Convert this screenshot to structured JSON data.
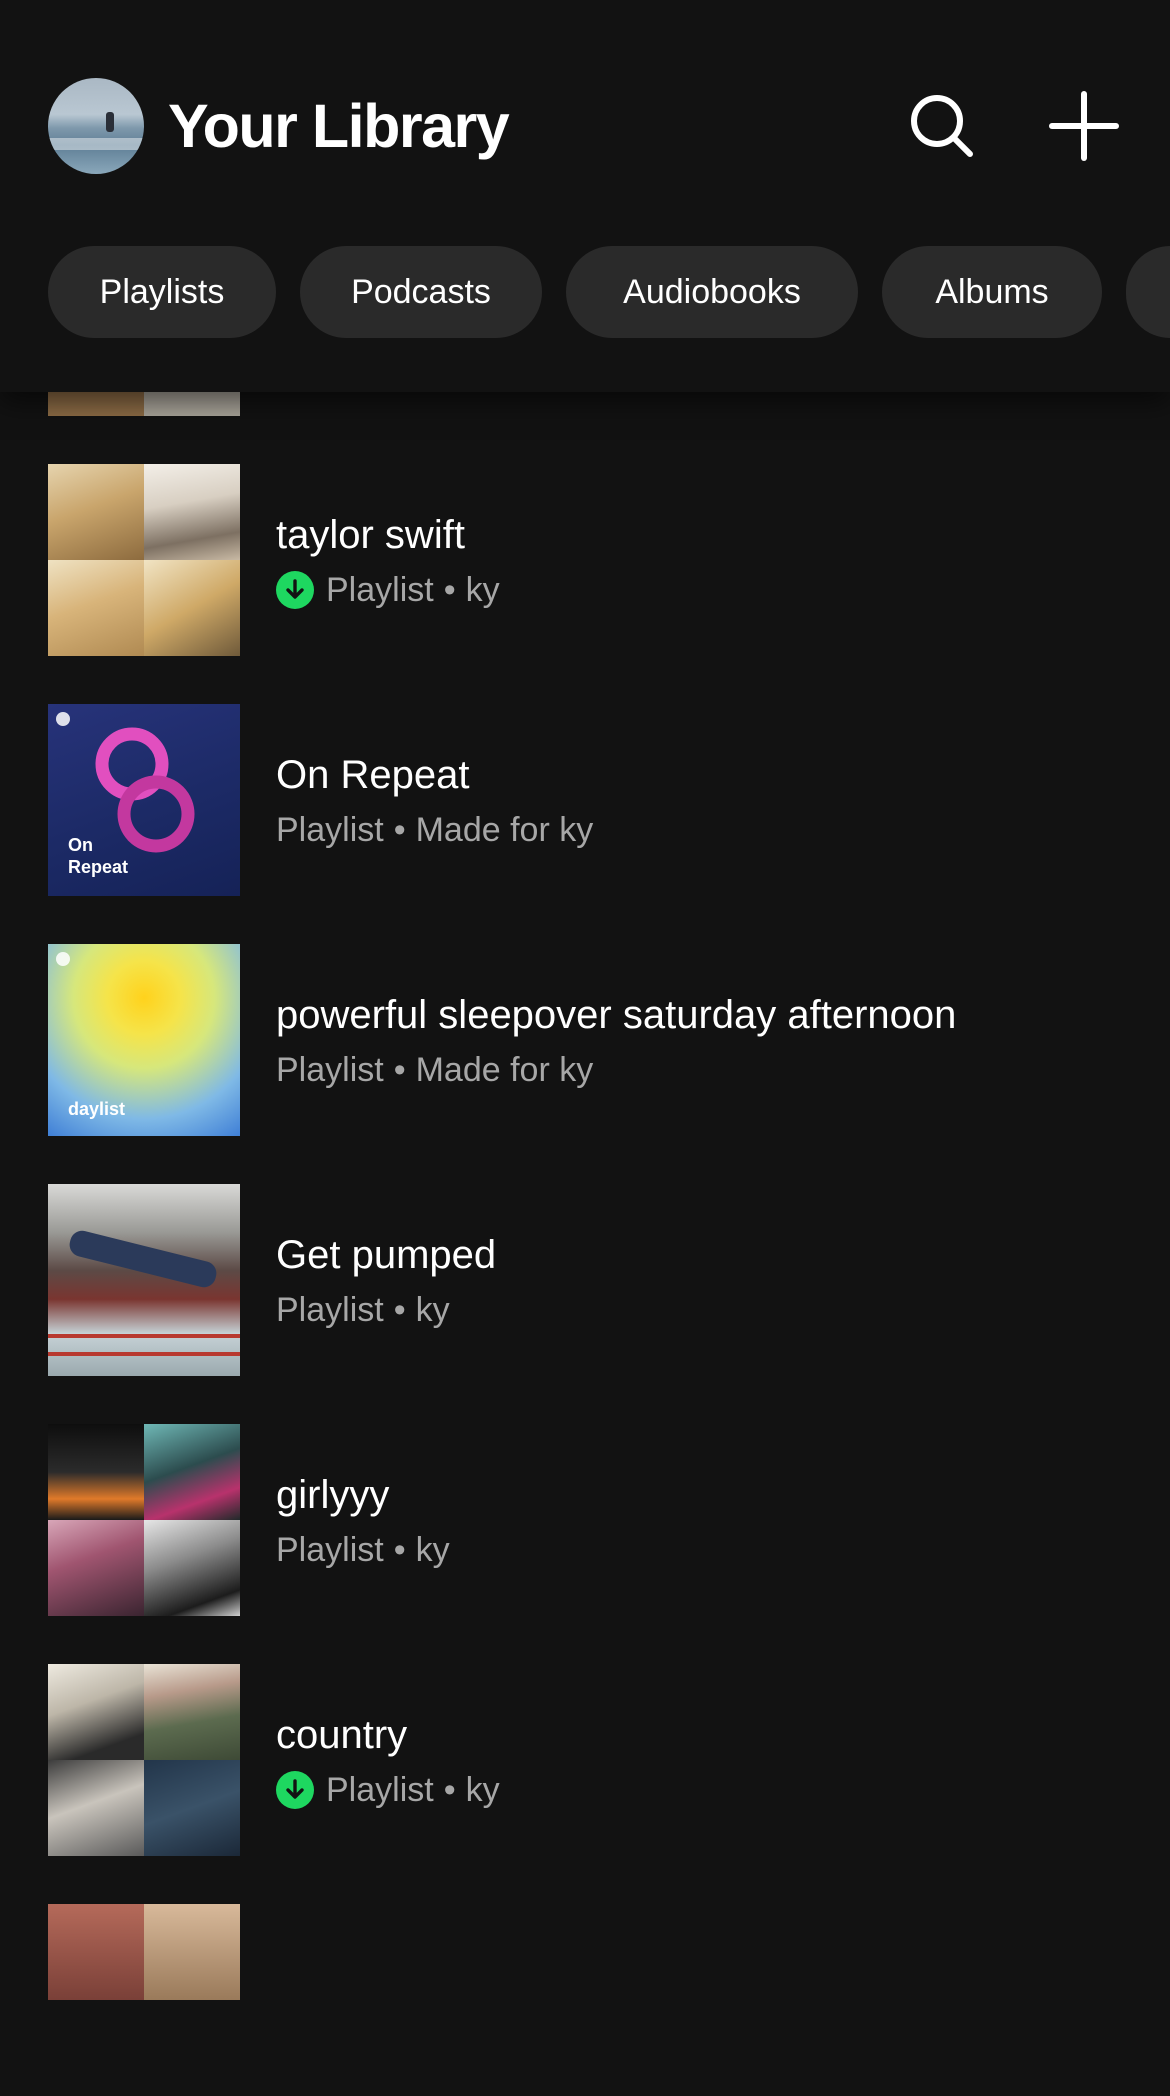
{
  "header": {
    "title": "Your Library",
    "search_icon": "search-icon",
    "add_icon": "plus-icon"
  },
  "filters": [
    {
      "label": "Playlists"
    },
    {
      "label": "Podcasts"
    },
    {
      "label": "Audiobooks"
    },
    {
      "label": "Albums"
    },
    {
      "label": ""
    }
  ],
  "library_items": [
    {
      "title": "taylor swift",
      "type": "Playlist",
      "owner": "ky",
      "downloaded": true
    },
    {
      "title": "On Repeat",
      "type": "Playlist",
      "owner": "Made for ky",
      "downloaded": false,
      "cover_label": "On Repeat"
    },
    {
      "title": "powerful sleepover saturday afternoon",
      "type": "Playlist",
      "owner": "Made for ky",
      "downloaded": false,
      "cover_label": "daylist"
    },
    {
      "title": "Get pumped",
      "type": "Playlist",
      "owner": "ky",
      "downloaded": false
    },
    {
      "title": "girlyyy",
      "type": "Playlist",
      "owner": "ky",
      "downloaded": false
    },
    {
      "title": "country",
      "type": "Playlist",
      "owner": "ky",
      "downloaded": true
    }
  ],
  "colors": {
    "background": "#121212",
    "chip": "#2a2a2a",
    "download_green": "#1ed760",
    "secondary_text": "#a7a7a7"
  }
}
